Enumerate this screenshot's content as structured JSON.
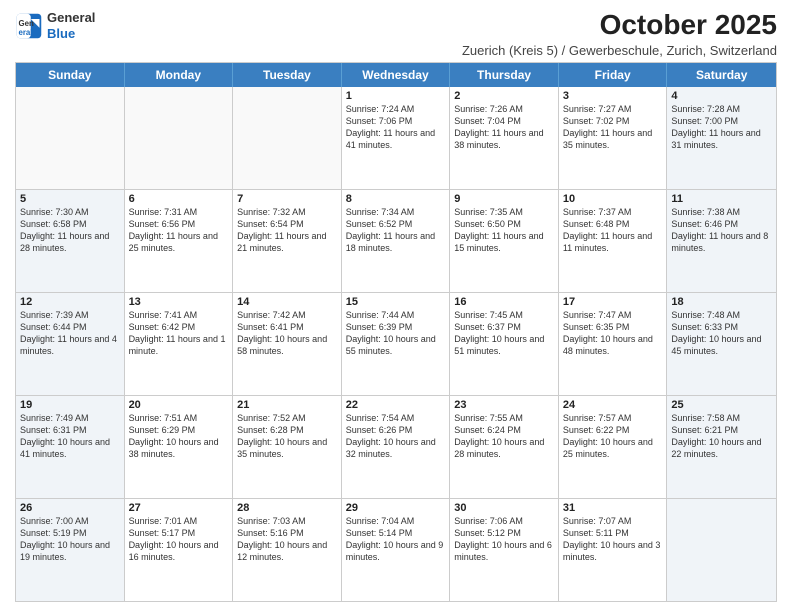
{
  "header": {
    "logo_general": "General",
    "logo_blue": "Blue",
    "month_title": "October 2025",
    "subtitle": "Zuerich (Kreis 5) / Gewerbeschule, Zurich, Switzerland"
  },
  "days_of_week": [
    "Sunday",
    "Monday",
    "Tuesday",
    "Wednesday",
    "Thursday",
    "Friday",
    "Saturday"
  ],
  "rows": [
    [
      {
        "day": "",
        "info": "",
        "shaded": false
      },
      {
        "day": "",
        "info": "",
        "shaded": false
      },
      {
        "day": "",
        "info": "",
        "shaded": false
      },
      {
        "day": "1",
        "info": "Sunrise: 7:24 AM\nSunset: 7:06 PM\nDaylight: 11 hours and 41 minutes.",
        "shaded": false
      },
      {
        "day": "2",
        "info": "Sunrise: 7:26 AM\nSunset: 7:04 PM\nDaylight: 11 hours and 38 minutes.",
        "shaded": false
      },
      {
        "day": "3",
        "info": "Sunrise: 7:27 AM\nSunset: 7:02 PM\nDaylight: 11 hours and 35 minutes.",
        "shaded": false
      },
      {
        "day": "4",
        "info": "Sunrise: 7:28 AM\nSunset: 7:00 PM\nDaylight: 11 hours and 31 minutes.",
        "shaded": true
      }
    ],
    [
      {
        "day": "5",
        "info": "Sunrise: 7:30 AM\nSunset: 6:58 PM\nDaylight: 11 hours and 28 minutes.",
        "shaded": true
      },
      {
        "day": "6",
        "info": "Sunrise: 7:31 AM\nSunset: 6:56 PM\nDaylight: 11 hours and 25 minutes.",
        "shaded": false
      },
      {
        "day": "7",
        "info": "Sunrise: 7:32 AM\nSunset: 6:54 PM\nDaylight: 11 hours and 21 minutes.",
        "shaded": false
      },
      {
        "day": "8",
        "info": "Sunrise: 7:34 AM\nSunset: 6:52 PM\nDaylight: 11 hours and 18 minutes.",
        "shaded": false
      },
      {
        "day": "9",
        "info": "Sunrise: 7:35 AM\nSunset: 6:50 PM\nDaylight: 11 hours and 15 minutes.",
        "shaded": false
      },
      {
        "day": "10",
        "info": "Sunrise: 7:37 AM\nSunset: 6:48 PM\nDaylight: 11 hours and 11 minutes.",
        "shaded": false
      },
      {
        "day": "11",
        "info": "Sunrise: 7:38 AM\nSunset: 6:46 PM\nDaylight: 11 hours and 8 minutes.",
        "shaded": true
      }
    ],
    [
      {
        "day": "12",
        "info": "Sunrise: 7:39 AM\nSunset: 6:44 PM\nDaylight: 11 hours and 4 minutes.",
        "shaded": true
      },
      {
        "day": "13",
        "info": "Sunrise: 7:41 AM\nSunset: 6:42 PM\nDaylight: 11 hours and 1 minute.",
        "shaded": false
      },
      {
        "day": "14",
        "info": "Sunrise: 7:42 AM\nSunset: 6:41 PM\nDaylight: 10 hours and 58 minutes.",
        "shaded": false
      },
      {
        "day": "15",
        "info": "Sunrise: 7:44 AM\nSunset: 6:39 PM\nDaylight: 10 hours and 55 minutes.",
        "shaded": false
      },
      {
        "day": "16",
        "info": "Sunrise: 7:45 AM\nSunset: 6:37 PM\nDaylight: 10 hours and 51 minutes.",
        "shaded": false
      },
      {
        "day": "17",
        "info": "Sunrise: 7:47 AM\nSunset: 6:35 PM\nDaylight: 10 hours and 48 minutes.",
        "shaded": false
      },
      {
        "day": "18",
        "info": "Sunrise: 7:48 AM\nSunset: 6:33 PM\nDaylight: 10 hours and 45 minutes.",
        "shaded": true
      }
    ],
    [
      {
        "day": "19",
        "info": "Sunrise: 7:49 AM\nSunset: 6:31 PM\nDaylight: 10 hours and 41 minutes.",
        "shaded": true
      },
      {
        "day": "20",
        "info": "Sunrise: 7:51 AM\nSunset: 6:29 PM\nDaylight: 10 hours and 38 minutes.",
        "shaded": false
      },
      {
        "day": "21",
        "info": "Sunrise: 7:52 AM\nSunset: 6:28 PM\nDaylight: 10 hours and 35 minutes.",
        "shaded": false
      },
      {
        "day": "22",
        "info": "Sunrise: 7:54 AM\nSunset: 6:26 PM\nDaylight: 10 hours and 32 minutes.",
        "shaded": false
      },
      {
        "day": "23",
        "info": "Sunrise: 7:55 AM\nSunset: 6:24 PM\nDaylight: 10 hours and 28 minutes.",
        "shaded": false
      },
      {
        "day": "24",
        "info": "Sunrise: 7:57 AM\nSunset: 6:22 PM\nDaylight: 10 hours and 25 minutes.",
        "shaded": false
      },
      {
        "day": "25",
        "info": "Sunrise: 7:58 AM\nSunset: 6:21 PM\nDaylight: 10 hours and 22 minutes.",
        "shaded": true
      }
    ],
    [
      {
        "day": "26",
        "info": "Sunrise: 7:00 AM\nSunset: 5:19 PM\nDaylight: 10 hours and 19 minutes.",
        "shaded": true
      },
      {
        "day": "27",
        "info": "Sunrise: 7:01 AM\nSunset: 5:17 PM\nDaylight: 10 hours and 16 minutes.",
        "shaded": false
      },
      {
        "day": "28",
        "info": "Sunrise: 7:03 AM\nSunset: 5:16 PM\nDaylight: 10 hours and 12 minutes.",
        "shaded": false
      },
      {
        "day": "29",
        "info": "Sunrise: 7:04 AM\nSunset: 5:14 PM\nDaylight: 10 hours and 9 minutes.",
        "shaded": false
      },
      {
        "day": "30",
        "info": "Sunrise: 7:06 AM\nSunset: 5:12 PM\nDaylight: 10 hours and 6 minutes.",
        "shaded": false
      },
      {
        "day": "31",
        "info": "Sunrise: 7:07 AM\nSunset: 5:11 PM\nDaylight: 10 hours and 3 minutes.",
        "shaded": false
      },
      {
        "day": "",
        "info": "",
        "shaded": true
      }
    ]
  ]
}
